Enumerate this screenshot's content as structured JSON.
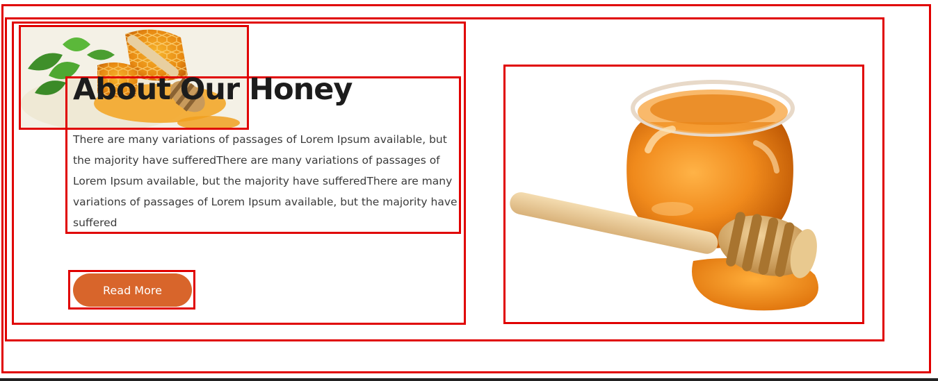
{
  "about": {
    "title": "About Our Honey",
    "paragraph": "There are many variations of passages of Lorem Ipsum available, but the majority have sufferedThere are many variations of passages of Lorem Ipsum available, but the majority have sufferedThere are many variations of passages of Lorem Ipsum available, but the majority have suffered",
    "button_label": "Read More"
  },
  "colors": {
    "accent": "#d8652b",
    "outline": "#e00000",
    "heading": "#1c1c1c",
    "body_text": "#3a3a3a"
  },
  "images": {
    "decor": "honeycomb-dipper-mint-image",
    "main": "honey-jar-dipper-image"
  }
}
